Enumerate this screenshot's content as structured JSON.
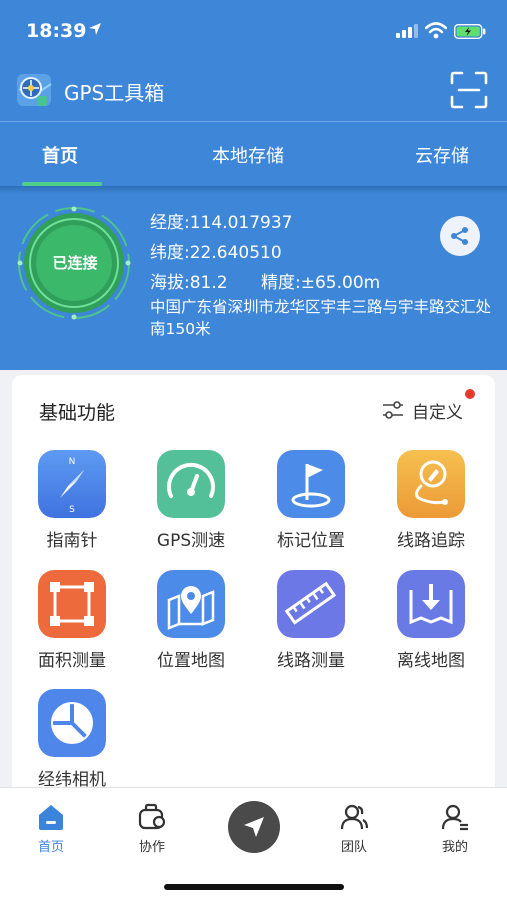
{
  "status_bar": {
    "time": "18:39"
  },
  "header": {
    "title": "GPS工具箱"
  },
  "tabs": [
    {
      "label": "首页"
    },
    {
      "label": "本地存储"
    },
    {
      "label": "云存储"
    }
  ],
  "location": {
    "connection": "已连接",
    "longitude": "经度:114.017937",
    "latitude": "纬度:22.640510",
    "altitude": "海拔:81.2",
    "accuracy": "精度:±65.00m",
    "address": "中国广东省深圳市龙华区宇丰三路与宇丰路交汇处南150米"
  },
  "functions": {
    "title": "基础功能",
    "customize": "自定义",
    "items": [
      {
        "label": "指南针",
        "icon": "compass-icon",
        "color": "#4f86ea"
      },
      {
        "label": "GPS测速",
        "icon": "speedometer-icon",
        "color": "#53c09a"
      },
      {
        "label": "标记位置",
        "icon": "flag-icon",
        "color": "#4d8be8"
      },
      {
        "label": "线路追踪",
        "icon": "route-pen-icon",
        "color": "#f0a843"
      },
      {
        "label": "面积测量",
        "icon": "area-measure-icon",
        "color": "#ec6a3b"
      },
      {
        "label": "位置地图",
        "icon": "map-pin-icon",
        "color": "#4d8be8"
      },
      {
        "label": "线路测量",
        "icon": "ruler-icon",
        "color": "#6c78e6"
      },
      {
        "label": "离线地图",
        "icon": "offline-map-icon",
        "color": "#6a7ae4"
      },
      {
        "label": "经纬相机",
        "icon": "lens-icon",
        "color": "#4f86ea"
      }
    ]
  },
  "bottom_nav": [
    {
      "label": "首页",
      "icon": "home-icon"
    },
    {
      "label": "协作",
      "icon": "collab-icon"
    },
    {
      "label": "",
      "icon": "navigate-icon"
    },
    {
      "label": "团队",
      "icon": "team-icon"
    },
    {
      "label": "我的",
      "icon": "profile-icon"
    }
  ],
  "colors": {
    "primary": "#3d86d8",
    "accent_green": "#4fd08a",
    "active_nav": "#3a84dc",
    "badge_red": "#e53a2e"
  }
}
